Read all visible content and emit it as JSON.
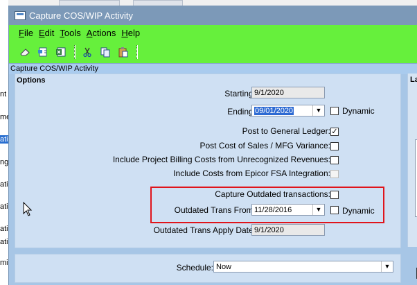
{
  "background_fragments": [
    "nt",
    "me",
    "ati",
    "ng",
    "ati",
    "ati",
    "ati",
    "ati",
    "mi"
  ],
  "window": {
    "title": "Capture COS/WIP Activity"
  },
  "menu": [
    {
      "label": "File",
      "key": "F",
      "rest": "ile"
    },
    {
      "label": "Edit",
      "key": "E",
      "rest": "dit"
    },
    {
      "label": "Tools",
      "key": "T",
      "rest": "ools"
    },
    {
      "label": "Actions",
      "key": "A",
      "rest": "ctions"
    },
    {
      "label": "Help",
      "key": "H",
      "rest": "elp"
    }
  ],
  "toolbar_icons": [
    "clear-icon",
    "new-icon",
    "excel-icon",
    "cut-icon",
    "copy-icon",
    "paste-icon"
  ],
  "breadcrumb": "Capture COS/WIP Activity",
  "options": {
    "title": "Options",
    "starting_label": "Starting:",
    "starting_value": "9/1/2020",
    "ending_label": "Ending:",
    "ending_value": "09/01/2020",
    "dynamic_label": "Dynamic",
    "post_gl_label": "Post to General Ledger:",
    "post_gl_checked": true,
    "post_cos_label": "Post Cost of Sales / MFG Variance:",
    "include_billing_label": "Include Project Billing Costs from Unrecognized Revenues:",
    "include_fsa_label": "Include Costs from Epicor FSA Integration:",
    "capture_outdated_label": "Capture Outdated transactions:",
    "outdated_from_label": "Outdated Trans From:",
    "outdated_from_value": "11/28/2016",
    "outdated_dynamic_label": "Dynamic",
    "apply_date_label": "Outdated Trans Apply Date:",
    "apply_date_value": "9/1/2020"
  },
  "schedule": {
    "label": "Schedule:",
    "value": "Now"
  },
  "right_panel_label": "La",
  "colors": {
    "menubar": "#66f03c",
    "window_bg": "#a7c6e6",
    "panel_bg": "#cfe0f3",
    "highlight_box": "#e0141b"
  }
}
